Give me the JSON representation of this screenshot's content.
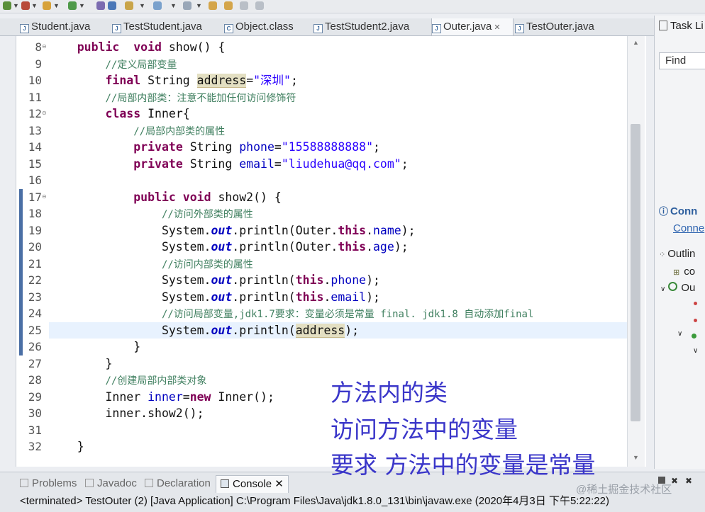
{
  "editor_tabs": [
    {
      "label": "Student.java",
      "active": false
    },
    {
      "label": "TestStudent.java",
      "active": false
    },
    {
      "label": "Object.class",
      "active": false
    },
    {
      "label": "TestStudent2.java",
      "active": false
    },
    {
      "label": "Outer.java",
      "active": true,
      "close": "✕"
    },
    {
      "label": "TestOuter.java",
      "active": false
    }
  ],
  "right_panel": {
    "task_list_label": "Task Li",
    "find_placeholder": "Find",
    "connect_title": "Conn",
    "connect_link": "Conne",
    "outline_title": "Outlin",
    "outline_item1": "co",
    "outline_item2": "Ou"
  },
  "code_lines": [
    {
      "n": "8",
      "tokens": [
        [
          "    ",
          ""
        ],
        [
          "public",
          "kw"
        ],
        [
          "  ",
          ""
        ],
        [
          "void",
          "kw"
        ],
        [
          " show() {",
          ""
        ]
      ]
    },
    {
      "n": "9",
      "tokens": [
        [
          "        ",
          ""
        ],
        [
          "//定义局部变量",
          "cm"
        ]
      ]
    },
    {
      "n": "10",
      "tokens": [
        [
          "        ",
          ""
        ],
        [
          "final",
          "kw"
        ],
        [
          " String ",
          ""
        ],
        [
          "address",
          "hl"
        ],
        [
          "=",
          ""
        ],
        [
          "\"深圳\"",
          "str"
        ],
        [
          ";",
          ""
        ]
      ]
    },
    {
      "n": "11",
      "tokens": [
        [
          "        ",
          ""
        ],
        [
          "//局部内部类：注意不能加任何访问修饰符",
          "cm"
        ]
      ]
    },
    {
      "n": "12",
      "tokens": [
        [
          "        ",
          ""
        ],
        [
          "class",
          "kw"
        ],
        [
          " Inner{",
          ""
        ]
      ]
    },
    {
      "n": "13",
      "tokens": [
        [
          "            ",
          ""
        ],
        [
          "//局部内部类的属性",
          "cm"
        ]
      ]
    },
    {
      "n": "14",
      "tokens": [
        [
          "            ",
          ""
        ],
        [
          "private",
          "kw"
        ],
        [
          " String ",
          ""
        ],
        [
          "phone",
          "fld"
        ],
        [
          "=",
          ""
        ],
        [
          "\"15588888888\"",
          "str"
        ],
        [
          ";",
          ""
        ]
      ]
    },
    {
      "n": "15",
      "tokens": [
        [
          "            ",
          ""
        ],
        [
          "private",
          "kw"
        ],
        [
          " String ",
          ""
        ],
        [
          "email",
          "fld"
        ],
        [
          "=",
          ""
        ],
        [
          "\"liudehua@qq.com\"",
          "str"
        ],
        [
          ";",
          ""
        ]
      ]
    },
    {
      "n": "16",
      "tokens": []
    },
    {
      "n": "17",
      "tokens": [
        [
          "            ",
          ""
        ],
        [
          "public",
          "kw"
        ],
        [
          " ",
          ""
        ],
        [
          "void",
          "kw"
        ],
        [
          " show2() {",
          ""
        ]
      ]
    },
    {
      "n": "18",
      "tokens": [
        [
          "                ",
          ""
        ],
        [
          "//访问外部类的属性",
          "cm"
        ]
      ]
    },
    {
      "n": "19",
      "tokens": [
        [
          "                System.",
          ""
        ],
        [
          "out",
          "st"
        ],
        [
          ".println(Outer.",
          ""
        ],
        [
          "this",
          "kw"
        ],
        [
          ".",
          ""
        ],
        [
          "name",
          "fld"
        ],
        [
          ");",
          ""
        ]
      ]
    },
    {
      "n": "20",
      "tokens": [
        [
          "                System.",
          ""
        ],
        [
          "out",
          "st"
        ],
        [
          ".println(Outer.",
          ""
        ],
        [
          "this",
          "kw"
        ],
        [
          ".",
          ""
        ],
        [
          "age",
          "fld"
        ],
        [
          ");",
          ""
        ]
      ]
    },
    {
      "n": "21",
      "tokens": [
        [
          "                ",
          ""
        ],
        [
          "//访问内部类的属性",
          "cm"
        ]
      ]
    },
    {
      "n": "22",
      "tokens": [
        [
          "                System.",
          ""
        ],
        [
          "out",
          "st"
        ],
        [
          ".println(",
          ""
        ],
        [
          "this",
          "kw"
        ],
        [
          ".",
          ""
        ],
        [
          "phone",
          "fld"
        ],
        [
          ");",
          ""
        ]
      ]
    },
    {
      "n": "23",
      "tokens": [
        [
          "                System.",
          ""
        ],
        [
          "out",
          "st"
        ],
        [
          ".println(",
          ""
        ],
        [
          "this",
          "kw"
        ],
        [
          ".",
          ""
        ],
        [
          "email",
          "fld"
        ],
        [
          ");",
          ""
        ]
      ]
    },
    {
      "n": "24",
      "tokens": [
        [
          "                ",
          ""
        ],
        [
          "//访问局部变量,jdk1.7要求：变量必须是常量 final. jdk1.8 自动添加final",
          "cm"
        ]
      ]
    },
    {
      "n": "25",
      "tokens": [
        [
          "                System.",
          ""
        ],
        [
          "out",
          "st"
        ],
        [
          ".println(",
          ""
        ],
        [
          "address",
          "hl"
        ],
        [
          ");",
          ""
        ]
      ]
    },
    {
      "n": "26",
      "tokens": [
        [
          "            }",
          ""
        ]
      ]
    },
    {
      "n": "27",
      "tokens": [
        [
          "        }",
          ""
        ]
      ]
    },
    {
      "n": "28",
      "tokens": [
        [
          "        ",
          ""
        ],
        [
          "//创建局部内部类对象",
          "cm"
        ]
      ]
    },
    {
      "n": "29",
      "tokens": [
        [
          "        Inner ",
          ""
        ],
        [
          "inner",
          "fld"
        ],
        [
          "=",
          ""
        ],
        [
          "new",
          "kw"
        ],
        [
          " Inner();",
          ""
        ]
      ]
    },
    {
      "n": "30",
      "tokens": [
        [
          "        inner.show2();",
          ""
        ]
      ]
    },
    {
      "n": "31",
      "tokens": []
    },
    {
      "n": "32",
      "tokens": [
        [
          "    }",
          ""
        ]
      ]
    }
  ],
  "bottom_tabs": [
    "Problems",
    "Javadoc",
    "Declaration",
    "Console ✕"
  ],
  "console_status": "<terminated> TestOuter (2) [Java Application] C:\\Program Files\\Java\\jdk1.8.0_131\\bin\\javaw.exe (2020年4月3日 下午5:22:22)",
  "subtitles": [
    "方法内的类",
    "访问方法中的变量",
    "要求 方法中的变量是常量"
  ],
  "watermark": "@稀土掘金技术社区",
  "colors": {
    "keyword": "#7f0055",
    "string": "#2a00ff",
    "comment": "#3f7f5f",
    "field": "#0000c0",
    "subtitle": "#3a36c9"
  }
}
